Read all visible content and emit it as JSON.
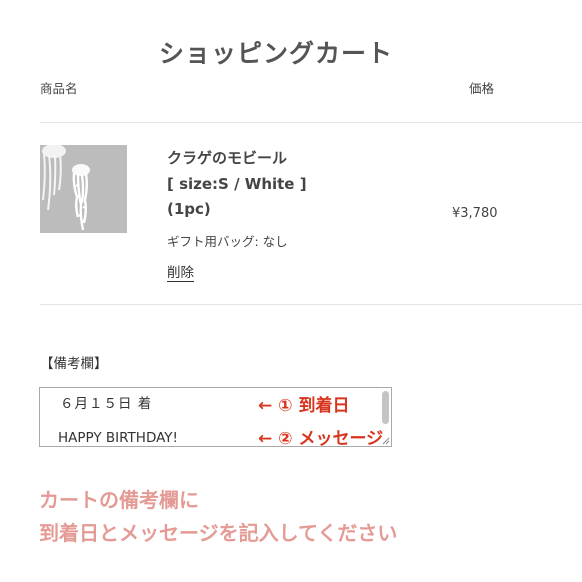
{
  "page_title": "ショッピングカート",
  "table": {
    "product_header": "商品名",
    "price_header": "価格"
  },
  "item": {
    "image_icon": "jellyfish-mobile-photo",
    "name_line1": "クラゲのモビール",
    "name_line2": "[ size:S / White ]",
    "name_line3": "(1pc)",
    "gift_bag": "ギフト用バッグ: なし",
    "remove_label": "削除",
    "price": "¥3,780"
  },
  "notes": {
    "label": "【備考欄】",
    "line1": "６月１５日 着",
    "line2": "HAPPY BIRTHDAY!"
  },
  "annotations": {
    "first": "← ① 到着日",
    "second": "← ② メッセージ",
    "color": "#d8341e"
  },
  "instruction": {
    "line1": "カートの備考欄に",
    "line2": "到着日とメッセージを記入してください",
    "color": "#e59b95"
  }
}
